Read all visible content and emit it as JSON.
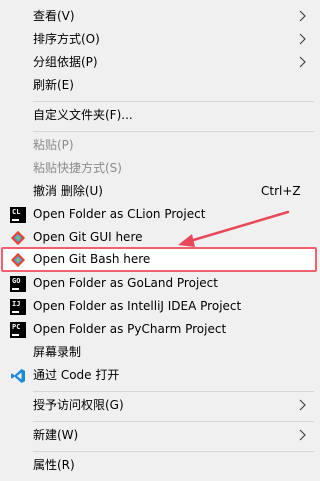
{
  "menu": {
    "view": "查看(V)",
    "sort": "排序方式(O)",
    "group": "分组依据(P)",
    "refresh": "刷新(E)",
    "customize": "自定义文件夹(F)...",
    "paste": "粘贴(P)",
    "paste_shortcut": "粘贴快捷方式(S)",
    "undo": "撤消 删除(U)",
    "undo_shortcut": "Ctrl+Z",
    "clion": "Open Folder as CLion Project",
    "git_gui": "Open Git GUI here",
    "git_bash": "Open Git Bash here",
    "goland": "Open Folder as GoLand Project",
    "intellij": "Open Folder as IntelliJ IDEA Project",
    "pycharm": "Open Folder as PyCharm Project",
    "screen_record": "屏幕录制",
    "vscode": "通过 Code 打开",
    "grant_access": "授予访问权限(G)",
    "new": "新建(W)",
    "properties": "属性(R)"
  },
  "icons": {
    "clion": "CL",
    "goland": "GO",
    "pycharm": "PC",
    "intellij": "IJ"
  },
  "colors": {
    "highlight_border": "#f0606e",
    "arrow": "#e8495a",
    "git_red": "#e8412c",
    "vscode_blue": "#1e8ad6"
  }
}
